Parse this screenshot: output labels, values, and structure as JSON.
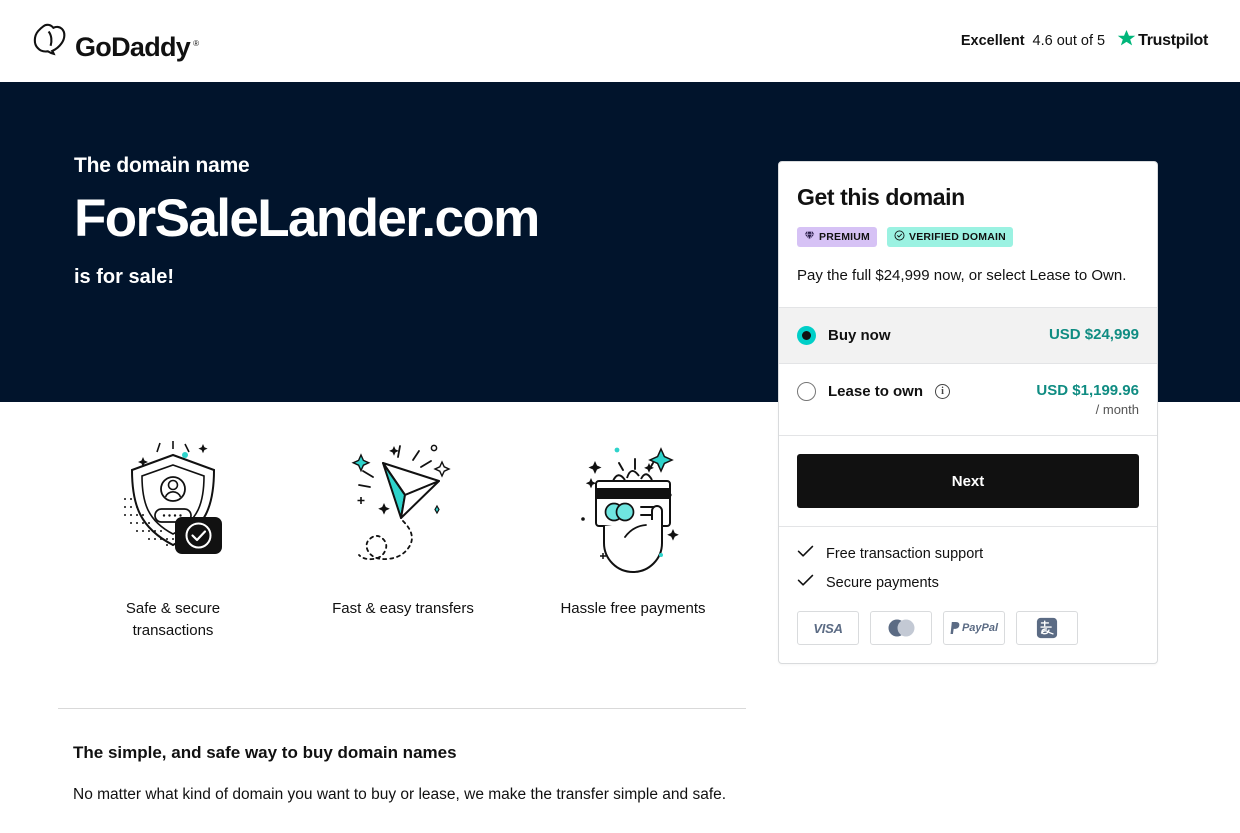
{
  "header": {
    "logo_text": "GoDaddy",
    "logo_tm": "®",
    "logo_icon": "godaddy-heart-logo",
    "trust": {
      "rating_word": "Excellent",
      "score_text": "4.6 out of 5",
      "brand": "Trustpilot",
      "star_icon": "trustpilot-star-icon",
      "star_color": "#00b67a"
    }
  },
  "hero": {
    "pre_text": "The domain name",
    "domain": "ForSaleLander.com",
    "post_text": "is for sale!",
    "background_color": "#01142c"
  },
  "features": [
    {
      "caption": "Safe & secure transactions",
      "art": "shield-lock-illustration"
    },
    {
      "caption": "Fast & easy transfers",
      "art": "paper-plane-illustration"
    },
    {
      "caption": "Hassle free payments",
      "art": "hand-credit-card-illustration"
    }
  ],
  "bottom": {
    "title": "The simple, and safe way to buy domain names",
    "body": "No matter what kind of domain you want to buy or lease, we make the transfer simple and safe."
  },
  "card": {
    "title": "Get this domain",
    "badges": [
      {
        "label": "PREMIUM",
        "icon": "diamond-icon",
        "color": "#d6c2f5"
      },
      {
        "label": "VERIFIED DOMAIN",
        "icon": "check-circle-icon",
        "color": "#9bf2e2"
      }
    ],
    "description": "Pay the full $24,999 now, or select Lease to Own.",
    "options": [
      {
        "label": "Buy now",
        "amount": "USD $24,999",
        "period": "",
        "selected": true,
        "has_info_icon": false
      },
      {
        "label": "Lease to own",
        "amount": "USD $1,199.96",
        "period": "/ month",
        "selected": false,
        "has_info_icon": true
      }
    ],
    "cta_label": "Next",
    "perks": [
      {
        "label": "Free transaction support",
        "icon": "check-icon"
      },
      {
        "label": "Secure payments",
        "icon": "check-icon"
      }
    ],
    "payment_methods": [
      {
        "name": "VISA",
        "icon": "visa-icon"
      },
      {
        "name": "Mastercard",
        "icon": "mastercard-icon"
      },
      {
        "name": "PayPal",
        "icon": "paypal-icon"
      },
      {
        "name": "Alipay",
        "icon": "alipay-icon"
      }
    ],
    "accent_color": "#0f8c82",
    "radio_color": "#00cfc8"
  }
}
